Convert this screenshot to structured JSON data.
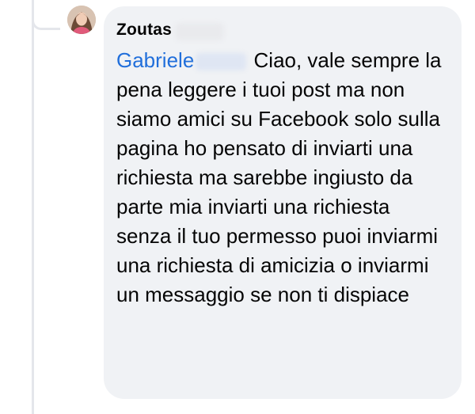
{
  "comment": {
    "author": {
      "name": "Zoutas",
      "avatar_icon": "user-avatar-icon"
    },
    "mention": "Gabriele",
    "body": "Ciao, vale sempre la pena leggere i tuoi post ma non siamo amici su Facebook solo sulla pagina ho pensato di inviarti una richiesta ma sarebbe ingiusto da parte mia inviarti una richiesta senza il tuo permesso puoi inviarmi una richiesta di amicizia o inviarmi un messaggio se non ti dispiace"
  },
  "colors": {
    "bubble_background": "#f0f2f5",
    "text": "#050505",
    "mention": "#216fdb",
    "thread_line": "#e4e6eb"
  }
}
